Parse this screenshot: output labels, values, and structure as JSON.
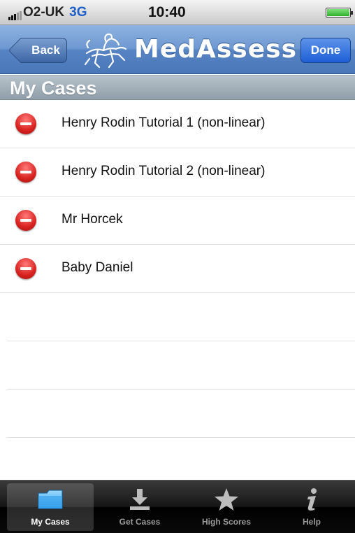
{
  "status_bar": {
    "carrier": "O2-UK",
    "network": "3G",
    "time": "10:40",
    "battery_level": 1.0
  },
  "nav_bar": {
    "back_label": "Back",
    "title": "MedAssess",
    "done_label": "Done",
    "logo_icon": "rider-horse-logo-icon"
  },
  "section": {
    "title": "My Cases"
  },
  "cases": [
    {
      "label": "Henry Rodin Tutorial 1 (non-linear)"
    },
    {
      "label": "Henry Rodin Tutorial 2 (non-linear)"
    },
    {
      "label": "Mr Horcek"
    },
    {
      "label": "Baby Daniel"
    }
  ],
  "tab_bar": {
    "tabs": [
      {
        "label": "My Cases",
        "icon": "folder-icon",
        "active": true
      },
      {
        "label": "Get Cases",
        "icon": "download-icon",
        "active": false
      },
      {
        "label": "High Scores",
        "icon": "star-icon",
        "active": false
      },
      {
        "label": "Help",
        "icon": "info-icon",
        "active": false
      }
    ]
  },
  "colors": {
    "nav_blue": "#5683c3",
    "done_blue": "#1d5fd6",
    "delete_red": "#d8221f",
    "network_blue": "#1f5fc9"
  }
}
